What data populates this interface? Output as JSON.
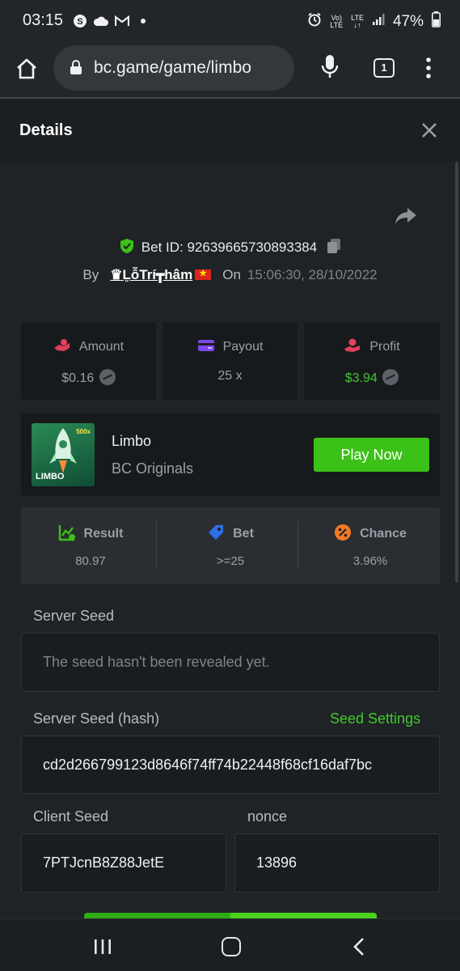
{
  "status_bar": {
    "time": "03:15",
    "network_top": "Vo)",
    "network_bottom": "LTE",
    "lte_top": "LTE",
    "lte_bottom": "↓↑",
    "battery": "47%"
  },
  "browser": {
    "url": "bc.game/game/limbo",
    "tab_count": "1"
  },
  "modal": {
    "title": "Details"
  },
  "bet": {
    "bet_id_label": "Bet ID: 92639665730893384",
    "by_label": "By",
    "username": "♛L͍ỗTrí┳hâm",
    "on_label": "On",
    "timestamp": "15:06:30, 28/10/2022"
  },
  "stats": {
    "amount": {
      "label": "Amount",
      "value": "$0.16"
    },
    "payout": {
      "label": "Payout",
      "value": "25 x"
    },
    "profit": {
      "label": "Profit",
      "value": "$3.94"
    }
  },
  "game": {
    "name": "Limbo",
    "provider": "BC Originals",
    "play_label": "Play Now",
    "thumb_text": "LIMBO",
    "thumb_badge": "500x"
  },
  "result": {
    "result": {
      "label": "Result",
      "value": "80.97"
    },
    "bet": {
      "label": "Bet",
      "value": ">=25"
    },
    "chance": {
      "label": "Chance",
      "value": "3.96%"
    }
  },
  "seeds": {
    "server_seed_label": "Server Seed",
    "server_seed_value": "The seed hasn't been revealed yet.",
    "server_hash_label": "Server Seed (hash)",
    "seed_settings_label": "Seed Settings",
    "server_hash_value": "cd2d266799123d8646f74ff74b22448f68cf16daf7bc",
    "client_seed_label": "Client Seed",
    "client_seed_value": "7PTJcnB8Z88JetE",
    "nonce_label": "nonce",
    "nonce_value": "13896"
  },
  "colors": {
    "accent_green": "#3bc117",
    "background": "#1f2326",
    "card": "#171a1c"
  }
}
